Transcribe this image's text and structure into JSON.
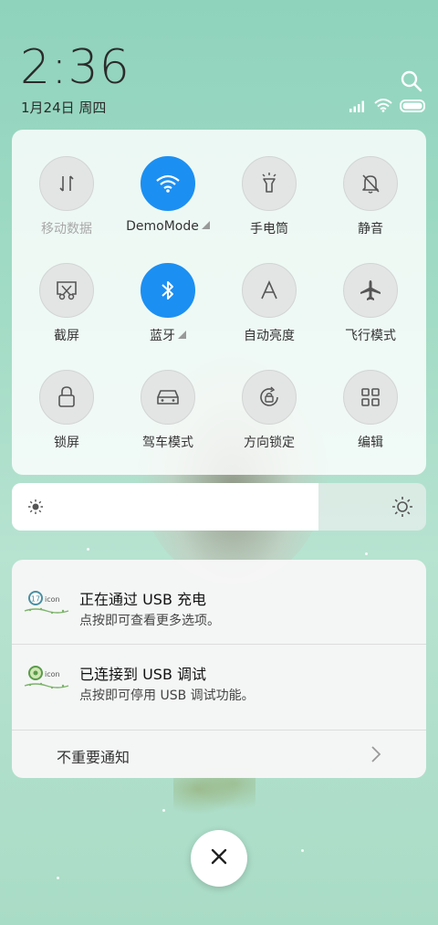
{
  "status": {
    "time": "2:36",
    "date": "1月24日 周四"
  },
  "quick_settings": {
    "tiles": [
      {
        "label": "移动数据",
        "icon": "mobile-data-icon",
        "active": false,
        "dim": true
      },
      {
        "label": "DemoMode",
        "icon": "wifi-icon",
        "active": true,
        "expandable": true
      },
      {
        "label": "手电筒",
        "icon": "flashlight-icon",
        "active": false
      },
      {
        "label": "静音",
        "icon": "mute-bell-icon",
        "active": false
      },
      {
        "label": "截屏",
        "icon": "screenshot-icon",
        "active": false
      },
      {
        "label": "蓝牙",
        "icon": "bluetooth-icon",
        "active": true,
        "expandable": true
      },
      {
        "label": "自动亮度",
        "icon": "auto-brightness-icon",
        "active": false
      },
      {
        "label": "飞行模式",
        "icon": "airplane-icon",
        "active": false
      },
      {
        "label": "锁屏",
        "icon": "lock-icon",
        "active": false
      },
      {
        "label": "驾车模式",
        "icon": "car-icon",
        "active": false
      },
      {
        "label": "方向锁定",
        "icon": "rotation-lock-icon",
        "active": false
      },
      {
        "label": "编辑",
        "icon": "grid-edit-icon",
        "active": false
      }
    ],
    "active_color": "#1c8ff2"
  },
  "brightness": {
    "level": 0.74
  },
  "notifications": [
    {
      "title": "正在通过 USB 充电",
      "body": "点按即可查看更多选项。",
      "icon_text": "icon"
    },
    {
      "title": "已连接到 USB 调试",
      "body": "点按即可停用 USB 调试功能。",
      "icon_text": "icon"
    }
  ],
  "unimportant_label": "不重要通知"
}
